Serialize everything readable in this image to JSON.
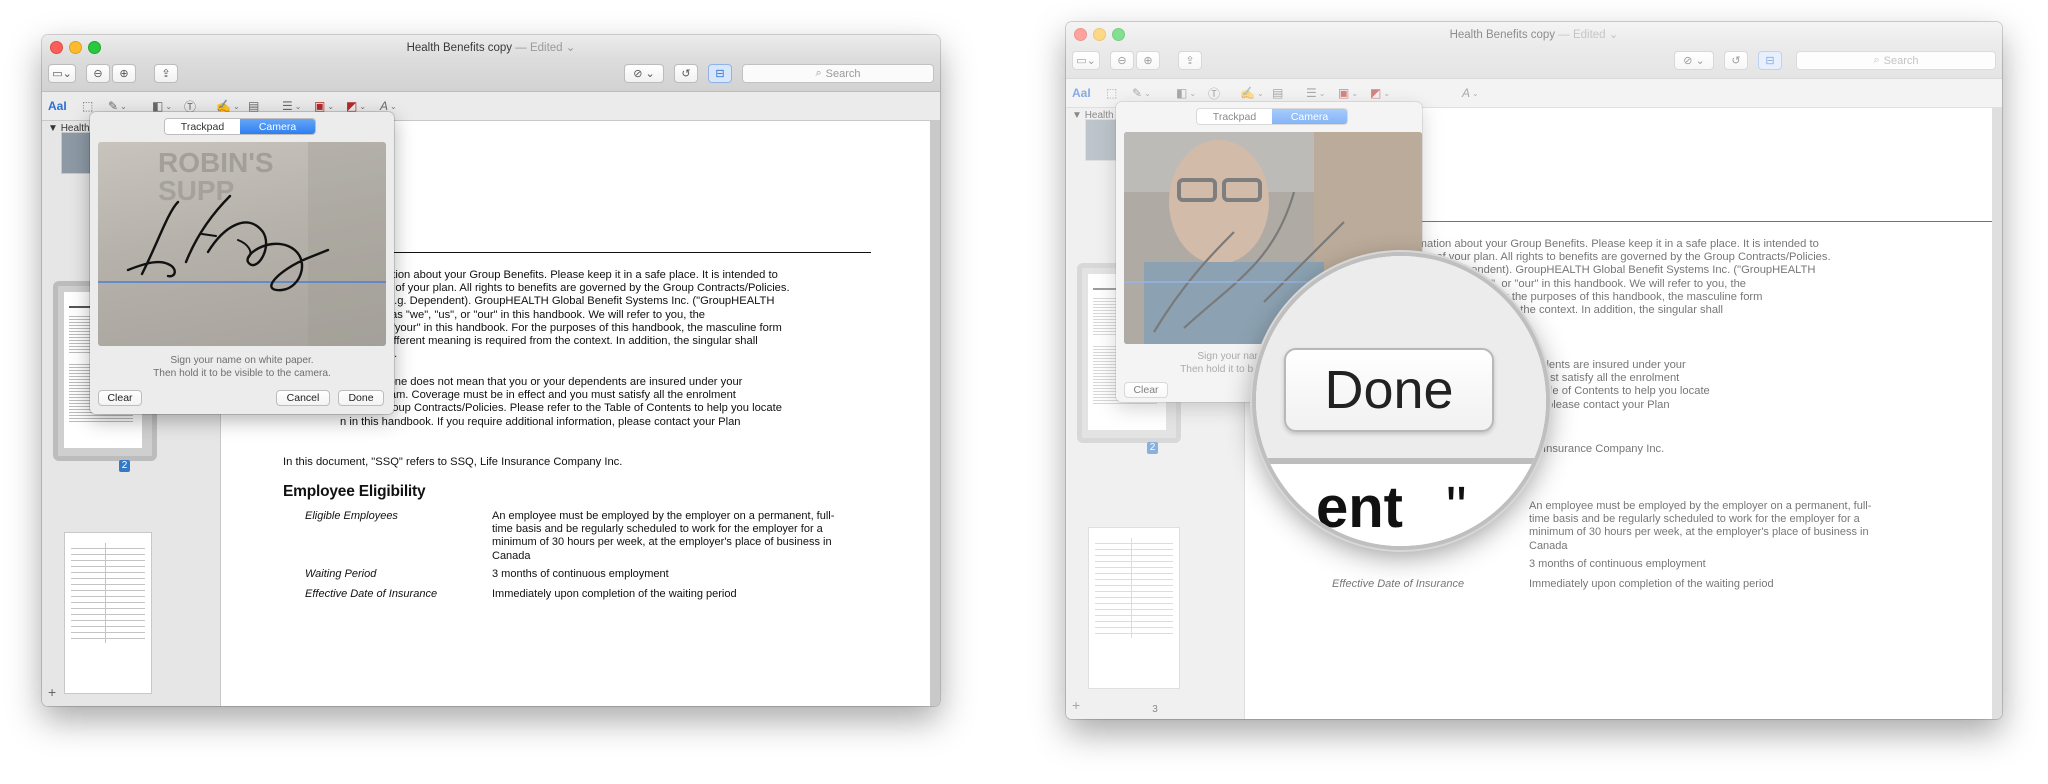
{
  "window": {
    "title": "Health Benefits copy",
    "edited": " — Edited",
    "search_placeholder": "Search",
    "sidebar_title": "Health Benefits copy"
  },
  "sidebar": {
    "current_page": "2",
    "next_page": "3"
  },
  "popover": {
    "tab_trackpad": "Trackpad",
    "tab_camera": "Camera",
    "instruction_line1": "Sign your name on white paper.",
    "instruction_line2": "Then hold it to be visible to the camera.",
    "clear_label": "Clear",
    "cancel_label": "Cancel",
    "done_label": "Done"
  },
  "left_doc": {
    "intro_lines": [
      "ns information about your Group Benefits.  Please keep it in a safe place.  It is intended to",
      "al features of your plan.  All rights to benefits are governed by the Group Contracts/Policies.",
      "pitalized (e.g. Dependent).  GroupHEALTH Global Benefit Systems Inc. (\"GroupHEALTH",
      "eferred to as \"we\", \"us\", or \"our\" in this handbook.  We will refer to you, the",
      "s \"you\" or \"your\" in this handbook.  For the purposes of this handbook, the masculine form",
      "unless a different meaning is required from the context.  In addition, the singular shall",
      "re required."
    ],
    "para2_lines": [
      "ndbook alone does not mean that you or your dependents are insured under your",
      "efits program.  Coverage must be in effect and you must satisfy all the enrolment",
      "d in the Group Contracts/Policies.  Please refer to the Table of Contents to help you locate",
      "n in this handbook.  If you require additional information, please contact your Plan"
    ],
    "ssq_line": "In this document, \"SSQ\" refers to SSQ, Life Insurance Company Inc."
  },
  "right_doc": {
    "intro_lines": [
      "ns information about your Group Benefits.  Please keep it in a safe place.  It is intended to",
      "al features of your plan.  All rights to benefits are governed by the Group Contracts/Policies.",
      "pitalized (e.g. Dependent).  GroupHEALTH Global Benefit Systems Inc. (\"GroupHEALTH",
      "eferred to as \"we\", \"us\", or \"our\" in this handbook.  We will refer to you, the",
      "our\" in this handbook.  For the purposes of this handbook, the masculine form",
      "nt meaning is required from the context.  In addition, the singular shall"
    ],
    "para2_lines": [
      "not mean that you or your dependents are insured under your",
      "rage must be in effect and you must satisfy all the enrolment",
      "ts/Policies.  Please refer to the Table of Contents to help you locate",
      "ou require additional information, please contact your Plan"
    ],
    "ssq_line": "Insurance Company Inc.",
    "mag_partial_text": "ent",
    "mag_partial_quote": "\""
  },
  "eligibility": {
    "heading": "Employee Eligibility",
    "rows": [
      {
        "label": "Eligible Employees",
        "lines": [
          "An employee must be employed by the employer on a permanent, full-",
          "time basis and be regularly scheduled to work for the employer for a",
          "minimum of 30 hours per week, at the employer's place of business in",
          "Canada"
        ]
      },
      {
        "label": "Waiting Period",
        "lines": [
          "3 months of continuous employment"
        ]
      },
      {
        "label": "Effective Date of Insurance",
        "lines": [
          "Immediately upon completion of the waiting period"
        ]
      }
    ]
  },
  "colors": {
    "accent": "#3478c6",
    "segment_on": "#2f7ef2",
    "signature": "#111111",
    "markup_red": "#b52a2a"
  }
}
